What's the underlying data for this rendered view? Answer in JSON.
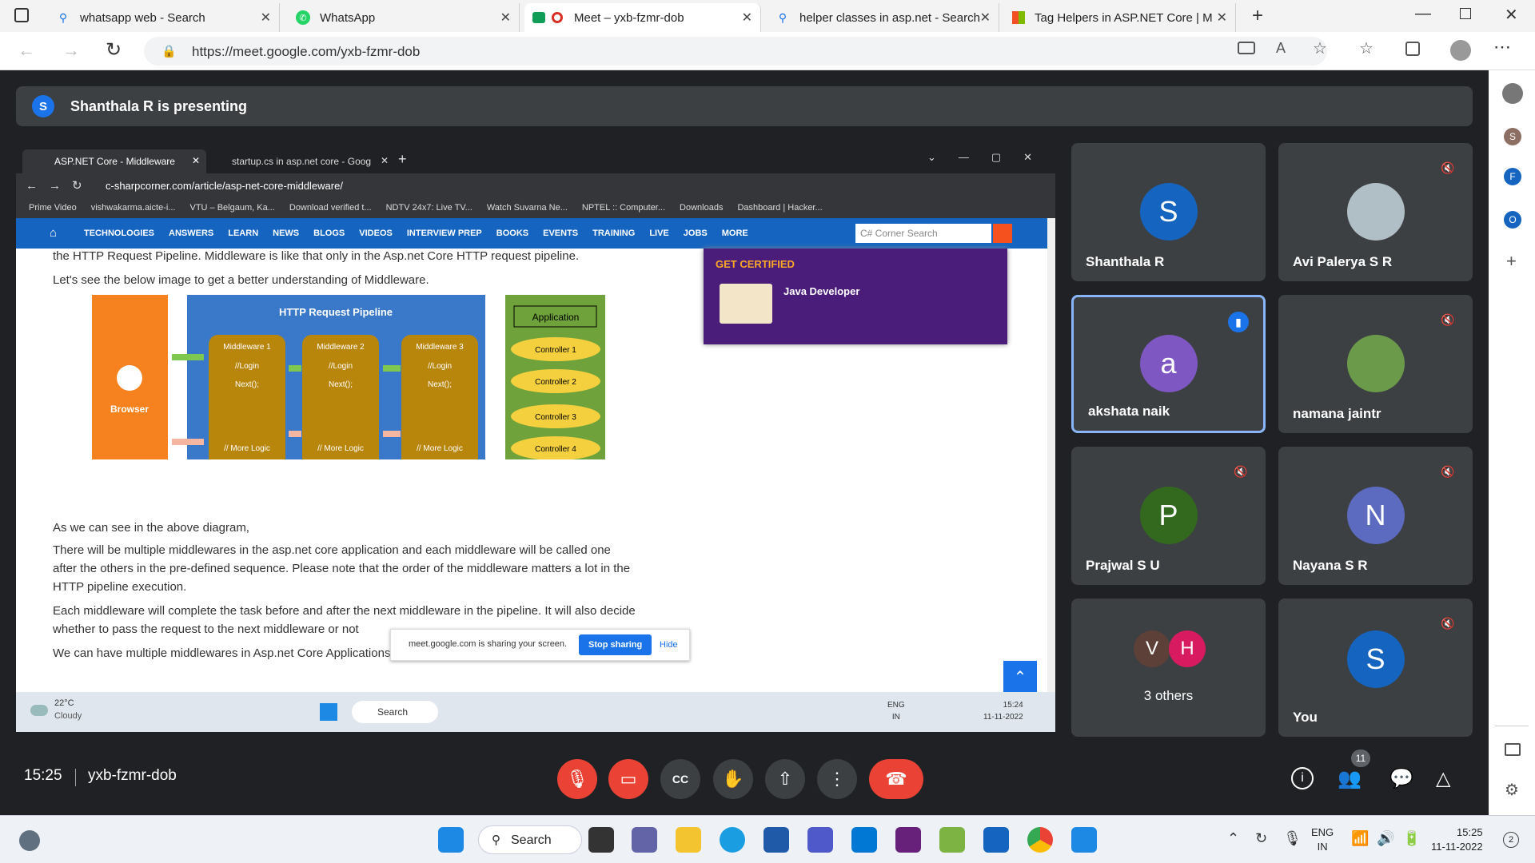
{
  "tabs": [
    {
      "title": "whatsapp web - Search",
      "icon": "search-icon"
    },
    {
      "title": "WhatsApp",
      "icon": "whatsapp-icon"
    },
    {
      "title": "Meet – yxb-fzmr-dob",
      "icon": "meet-icon"
    },
    {
      "title": "helper classes in asp.net - Search",
      "icon": "search-icon"
    },
    {
      "title": "Tag Helpers in ASP.NET Core | M",
      "icon": "microsoft-icon"
    }
  ],
  "address": {
    "url": "https://meet.google.com/yxb-fzmr-dob"
  },
  "meet": {
    "presenter_initial": "S",
    "presenter_banner": "Shanthala R is presenting",
    "time": "15:25",
    "meeting_code": "yxb-fzmr-dob",
    "participant_count": "11"
  },
  "shared": {
    "tabs": [
      "ASP.NET Core - Middleware",
      "startup.cs in asp.net core - Goog"
    ],
    "url": "c-sharpcorner.com/article/asp-net-core-middleware/",
    "bookmarks": [
      "Prime Video",
      "vishwakarma.aicte-i...",
      "VTU – Belgaum, Ka...",
      "Download verified t...",
      "NDTV 24x7: Live TV...",
      "Watch Suvarna Ne...",
      "NPTEL :: Computer...",
      "Downloads",
      "Dashboard | Hacker..."
    ],
    "nav": [
      "TECHNOLOGIES",
      "ANSWERS",
      "LEARN",
      "NEWS",
      "BLOGS",
      "VIDEOS",
      "INTERVIEW PREP",
      "BOOKS",
      "EVENTS",
      "TRAINING",
      "LIVE",
      "JOBS",
      "MORE"
    ],
    "search_placeholder": "C# Corner Search",
    "p1": "the HTTP Request Pipeline. Middleware is like that only in the Asp.net Core HTTP request pipeline.",
    "p2": "Let's see the below image to get a better understanding of Middleware.",
    "p3": "As we can see in the above diagram,",
    "p4a": "There will be multiple middlewares in the asp.net core application and each middleware will be called one",
    "p4b": "after the others in the pre-defined sequence. Please note that the order of the middleware matters a lot in the",
    "p4c": "HTTP pipeline execution.",
    "p5a": "Each middleware will complete the task before and after the next middleware in the pipeline. It will also decide",
    "p5b": "whether to pass the request to the next middleware or not",
    "p6": "We can have multiple middlewares in Asp.net Core Applications and it can be added through",
    "ad_title": "GET CERTIFIED",
    "ad_sub": "Java Developer",
    "diagram": {
      "browser": "Browser",
      "pipeline": "HTTP Request Pipeline",
      "application": "Application",
      "mw": [
        "Middleware 1",
        "Middleware 2",
        "Middleware 3"
      ],
      "login": "//Login",
      "next": "Next();",
      "more": "// More Logic",
      "controllers": [
        "Controller 1",
        "Controller 2",
        "Controller 3",
        "Controller 4"
      ]
    },
    "sharing_msg": "meet.google.com is sharing your screen.",
    "stop_sharing": "Stop sharing",
    "hide": "Hide",
    "weather_temp": "22°C",
    "weather_desc": "Cloudy",
    "tb_search": "Search",
    "lang1": "ENG",
    "lang2": "IN",
    "clock_time": "15:24",
    "clock_date": "11-11-2022"
  },
  "participants": [
    {
      "name": "Shanthala R",
      "initial": "S",
      "color": "#1565c0",
      "muted": false
    },
    {
      "name": "Avi Palerya S R",
      "initial": "",
      "color": "#9aa",
      "muted": true
    },
    {
      "name": "akshata naik",
      "initial": "a",
      "color": "#7e57c2",
      "muted": false,
      "speaking": true
    },
    {
      "name": "namana jaintr",
      "initial": "",
      "color": "#5a8a3a",
      "muted": true
    },
    {
      "name": "Prajwal S U",
      "initial": "P",
      "color": "#33691e",
      "muted": true
    },
    {
      "name": "Nayana S R",
      "initial": "N",
      "color": "#5c6bc0",
      "muted": true
    },
    {
      "name": "3 others",
      "initial": "V",
      "initial2": "H",
      "color": "#5d4037",
      "color2": "#d81b60"
    },
    {
      "name": "You",
      "initial": "S",
      "color": "#1565c0",
      "muted": true
    }
  ],
  "sidebar": {
    "items": [
      "S",
      "F",
      "O"
    ]
  },
  "os": {
    "search": "Search",
    "lang1": "ENG",
    "lang2": "IN",
    "time": "15:25",
    "date": "11-11-2022",
    "notif": "2"
  }
}
